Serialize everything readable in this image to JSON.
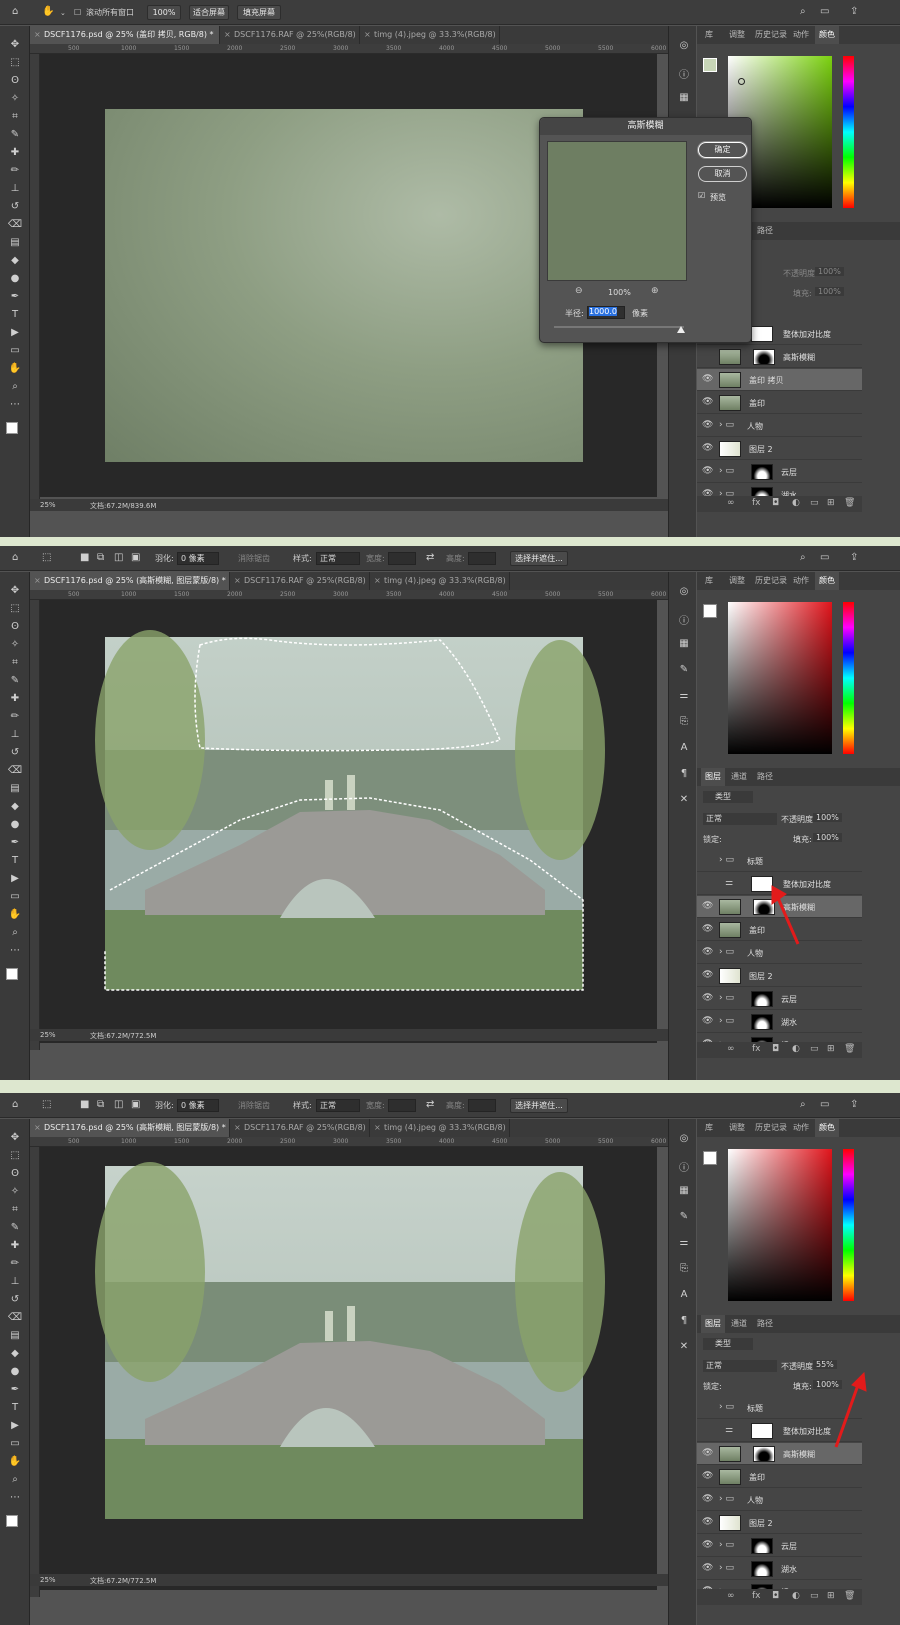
{
  "app": {
    "colors": {
      "accent": "#2a71e0",
      "panel_bg": "#535353",
      "dark_bg": "#3a3a3a",
      "arrow": "#e21b1b",
      "separator": "#dde7cf"
    }
  },
  "screens": [
    {
      "options": {
        "scroll_all": "滚动所有窗口",
        "zoom": "100%",
        "fit_screen": "适合屏幕",
        "fill_screen": "填充屏幕"
      },
      "tabs": [
        {
          "label": "DSCF1176.psd @ 25% (盖印 拷贝, RGB/8) *"
        },
        {
          "label": "DSCF1176.RAF @ 25%(RGB/8)"
        },
        {
          "label": "timg (4).jpeg @ 33.3%(RGB/8)"
        }
      ],
      "status": {
        "zoom": "25%",
        "doc": "文档:67.2M/839.6M"
      },
      "panel_tabs": [
        "库",
        "调整",
        "历史记录",
        "动作",
        "颜色"
      ],
      "layers_tabs": [
        "路径"
      ],
      "dialog": {
        "title": "高斯模糊",
        "ok": "确定",
        "cancel": "取消",
        "preview": "预览",
        "zoom": "100%",
        "radius_label": "半径:",
        "radius_value": "1000.0",
        "unit": "像素"
      },
      "opacity_label": "不透明度:",
      "opacity_value": "100%",
      "fill_label": "填充:",
      "fill_value": "100%",
      "layers": [
        {
          "name": "整体加对比度",
          "type": "adjust"
        },
        {
          "name": "高斯模糊",
          "type": "mask"
        },
        {
          "name": "盖印 拷贝",
          "type": "image",
          "selected": true
        },
        {
          "name": "盖印",
          "type": "image"
        },
        {
          "name": "人物",
          "type": "folder"
        },
        {
          "name": "图层 2",
          "type": "gradient"
        },
        {
          "name": "云层",
          "type": "folder-mask"
        },
        {
          "name": "湖水",
          "type": "folder-mask"
        }
      ]
    },
    {
      "options": {
        "feather_label": "羽化:",
        "feather_value": "0 像素",
        "antialias": "消除锯齿",
        "style_label": "样式:",
        "style_value": "正常",
        "width_label": "宽度:",
        "height_label": "高度:",
        "select_mask": "选择并遮住..."
      },
      "tabs": [
        {
          "label": "DSCF1176.psd @ 25% (高斯模糊, 图层蒙版/8) *"
        },
        {
          "label": "DSCF1176.RAF @ 25%(RGB/8)"
        },
        {
          "label": "timg (4).jpeg @ 33.3%(RGB/8)"
        }
      ],
      "status": {
        "zoom": "25%",
        "doc": "文档:67.2M/772.5M"
      },
      "panel_tabs": [
        "库",
        "调整",
        "历史记录",
        "动作",
        "颜色"
      ],
      "layers_tabs": [
        "图层",
        "通道",
        "路径"
      ],
      "filter_kind": "类型",
      "blend_mode": "正常",
      "opacity_label": "不透明度:",
      "opacity_value": "100%",
      "lock_label": "锁定:",
      "fill_label": "填充:",
      "fill_value": "100%",
      "layers": [
        {
          "name": "标题",
          "type": "folder"
        },
        {
          "name": "整体加对比度",
          "type": "adjust"
        },
        {
          "name": "高斯模糊",
          "type": "mask",
          "selected": true
        },
        {
          "name": "盖印",
          "type": "image"
        },
        {
          "name": "人物",
          "type": "folder"
        },
        {
          "name": "图层 2",
          "type": "gradient"
        },
        {
          "name": "云层",
          "type": "folder-mask"
        },
        {
          "name": "湖水",
          "type": "folder-mask"
        },
        {
          "name": "桥",
          "type": "folder-mask"
        }
      ]
    },
    {
      "options": {
        "feather_label": "羽化:",
        "feather_value": "0 像素",
        "antialias": "消除锯齿",
        "style_label": "样式:",
        "style_value": "正常",
        "width_label": "宽度:",
        "height_label": "高度:",
        "select_mask": "选择并遮住..."
      },
      "tabs": [
        {
          "label": "DSCF1176.psd @ 25% (高斯模糊, 图层蒙版/8) *"
        },
        {
          "label": "DSCF1176.RAF @ 25%(RGB/8)"
        },
        {
          "label": "timg (4).jpeg @ 33.3%(RGB/8)"
        }
      ],
      "status": {
        "zoom": "25%",
        "doc": "文档:67.2M/772.5M"
      },
      "panel_tabs": [
        "库",
        "调整",
        "历史记录",
        "动作",
        "颜色"
      ],
      "layers_tabs": [
        "图层",
        "通道",
        "路径"
      ],
      "filter_kind": "类型",
      "blend_mode": "正常",
      "opacity_label": "不透明度:",
      "opacity_value": "55%",
      "lock_label": "锁定:",
      "fill_label": "填充:",
      "fill_value": "100%",
      "layers": [
        {
          "name": "标题",
          "type": "folder"
        },
        {
          "name": "整体加对比度",
          "type": "adjust"
        },
        {
          "name": "高斯模糊",
          "type": "mask",
          "selected": true
        },
        {
          "name": "盖印",
          "type": "image"
        },
        {
          "name": "人物",
          "type": "folder"
        },
        {
          "name": "图层 2",
          "type": "gradient"
        },
        {
          "name": "云层",
          "type": "folder-mask"
        },
        {
          "name": "湖水",
          "type": "folder-mask"
        },
        {
          "name": "桥",
          "type": "folder-mask"
        }
      ]
    }
  ],
  "ruler_ticks": [
    "500",
    "1000",
    "1500",
    "2000",
    "2500",
    "3000",
    "3500",
    "4000",
    "4500",
    "5000",
    "5500",
    "6000"
  ]
}
